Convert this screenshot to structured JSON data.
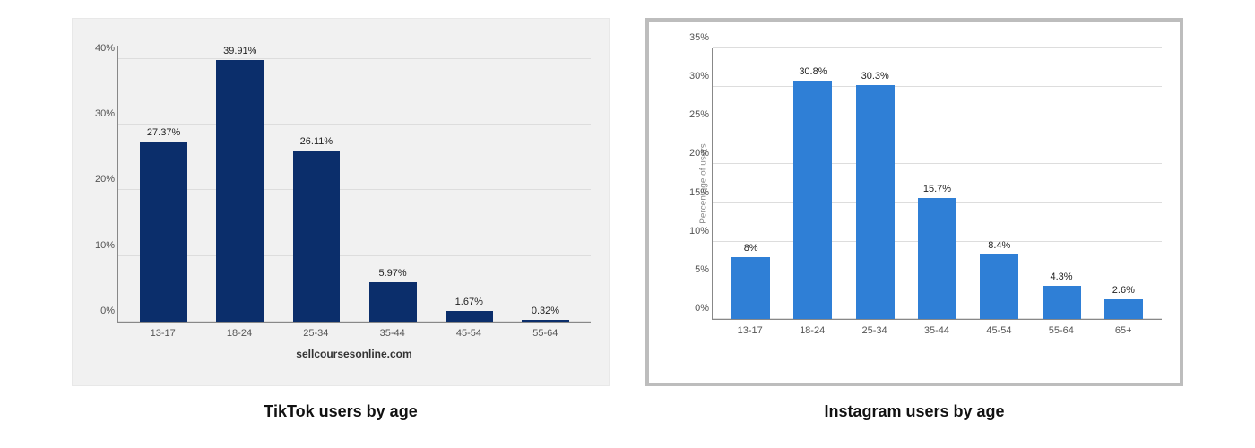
{
  "chart_data": [
    {
      "id": "tiktok",
      "type": "bar",
      "title": "TikTok users by age",
      "xlabel": "",
      "ylabel": "",
      "y_ticks": [
        "0%",
        "10%",
        "20%",
        "30%",
        "40%"
      ],
      "ylim": [
        0,
        42
      ],
      "categories": [
        "13-17",
        "18-24",
        "25-34",
        "35-44",
        "45-54",
        "55-64"
      ],
      "values": [
        27.37,
        39.91,
        26.11,
        5.97,
        1.67,
        0.32
      ],
      "value_labels": [
        "27.37%",
        "39.91%",
        "26.11%",
        "5.97%",
        "1.67%",
        "0.32%"
      ],
      "source": "sellcoursesonline.com",
      "bar_color": "#0b2e6b"
    },
    {
      "id": "instagram",
      "type": "bar",
      "title": "Instagram users by age",
      "xlabel": "",
      "ylabel": "Percentage of users",
      "y_ticks": [
        "0%",
        "5%",
        "10%",
        "15%",
        "20%",
        "25%",
        "30%",
        "35%"
      ],
      "ylim": [
        0,
        35
      ],
      "categories": [
        "13-17",
        "18-24",
        "25-34",
        "35-44",
        "45-54",
        "55-64",
        "65+"
      ],
      "values": [
        8,
        30.8,
        30.3,
        15.7,
        8.4,
        4.3,
        2.6
      ],
      "value_labels": [
        "8%",
        "30.8%",
        "30.3%",
        "15.7%",
        "8.4%",
        "4.3%",
        "2.6%"
      ],
      "source": "",
      "bar_color": "#2f7fd6"
    }
  ]
}
